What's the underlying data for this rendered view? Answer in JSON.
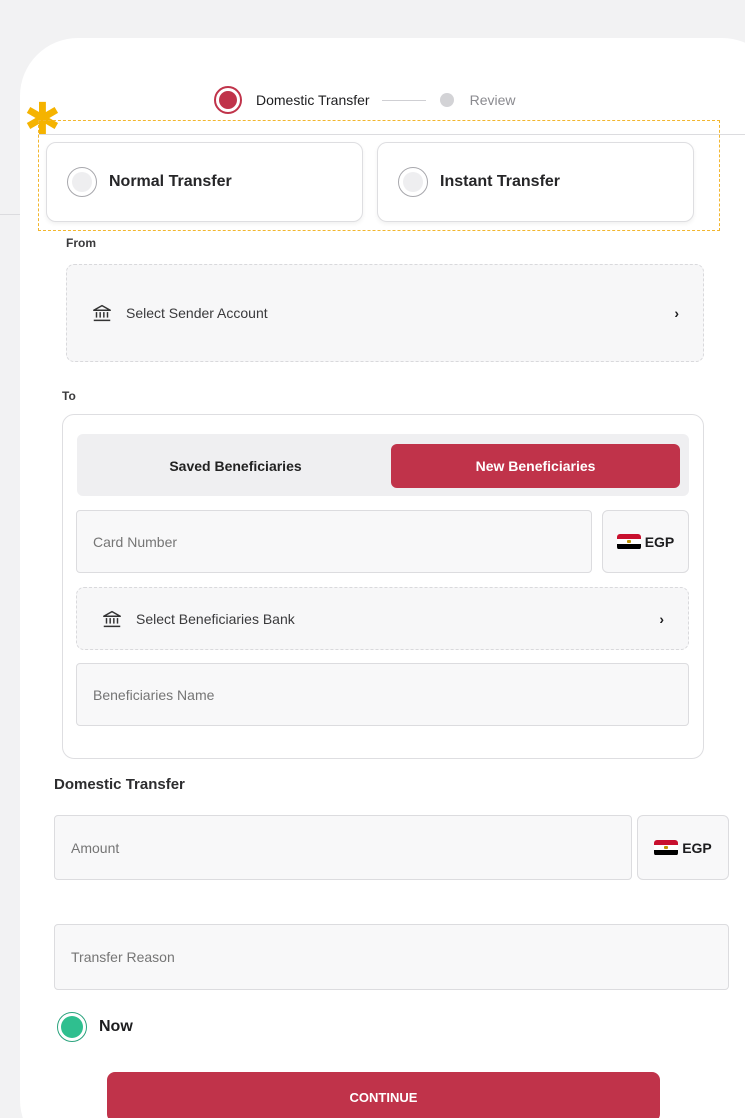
{
  "stepper": {
    "steps": [
      {
        "label": "Domestic Transfer",
        "state": "active"
      },
      {
        "label": "Review",
        "state": "inactive"
      }
    ]
  },
  "transfer_type": {
    "options": [
      {
        "label": "Normal Transfer",
        "selected": false
      },
      {
        "label": "Instant Transfer",
        "selected": false
      }
    ]
  },
  "from": {
    "label": "From",
    "sender_account_placeholder": "Select Sender Account"
  },
  "to": {
    "label": "To",
    "tabs": [
      {
        "label": "Saved Beneficiaries",
        "active": false
      },
      {
        "label": "New Beneficiaries",
        "active": true
      }
    ],
    "card_number_placeholder": "Card Number",
    "currency": "EGP",
    "bank_placeholder": "Select Beneficiaries Bank",
    "name_placeholder": "Beneficiaries Name"
  },
  "domestic": {
    "label": "Domestic Transfer",
    "amount_placeholder": "Amount",
    "currency": "EGP",
    "reason_placeholder": "Transfer Reason"
  },
  "schedule": {
    "label": "Now",
    "selected": true
  },
  "actions": {
    "continue_label": "CONTINUE"
  },
  "colors": {
    "primary": "#c0334a",
    "success": "#2fbf8f",
    "highlight": "#f2b62e"
  }
}
